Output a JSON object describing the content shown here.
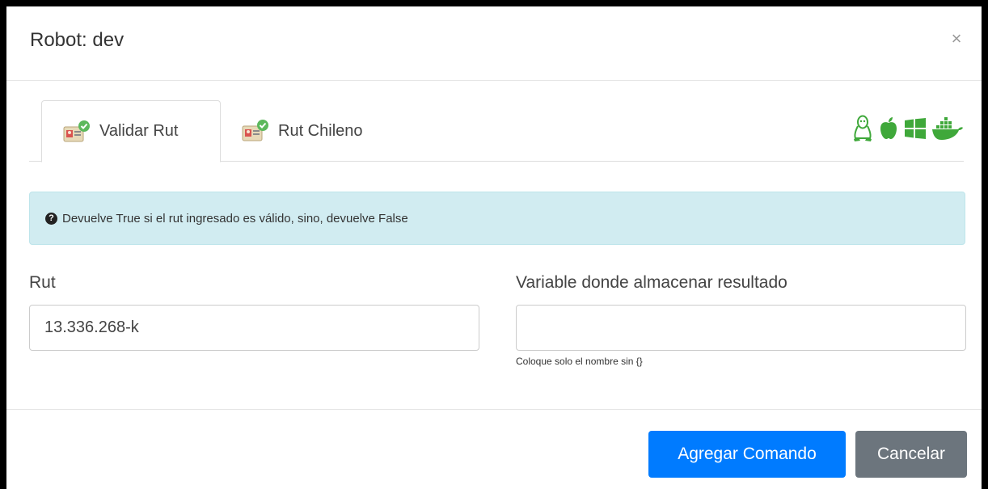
{
  "modal": {
    "title": "Robot: dev",
    "close_label": "×"
  },
  "tabs": [
    {
      "label": "Validar Rut",
      "active": true,
      "icon": "id-card-check-icon"
    },
    {
      "label": "Rut Chileno",
      "active": false,
      "icon": "id-card-check-icon"
    }
  ],
  "os_icons": [
    "linux-icon",
    "apple-icon",
    "windows-icon",
    "docker-icon"
  ],
  "colors": {
    "accent_green": "#3fa83a",
    "primary": "#007bff",
    "secondary": "#6c757d",
    "alert_bg": "#d1ecf1"
  },
  "alert": {
    "icon": "question-circle-icon",
    "text": "Devuelve True si el rut ingresado es válido, sino, devuelve False"
  },
  "form": {
    "rut": {
      "label": "Rut",
      "value": "13.336.268-k",
      "placeholder": ""
    },
    "variable": {
      "label": "Variable donde almacenar resultado",
      "value": "",
      "placeholder": "",
      "help": "Coloque solo el nombre sin {}"
    }
  },
  "footer": {
    "submit_label": "Agregar Comando",
    "cancel_label": "Cancelar"
  }
}
